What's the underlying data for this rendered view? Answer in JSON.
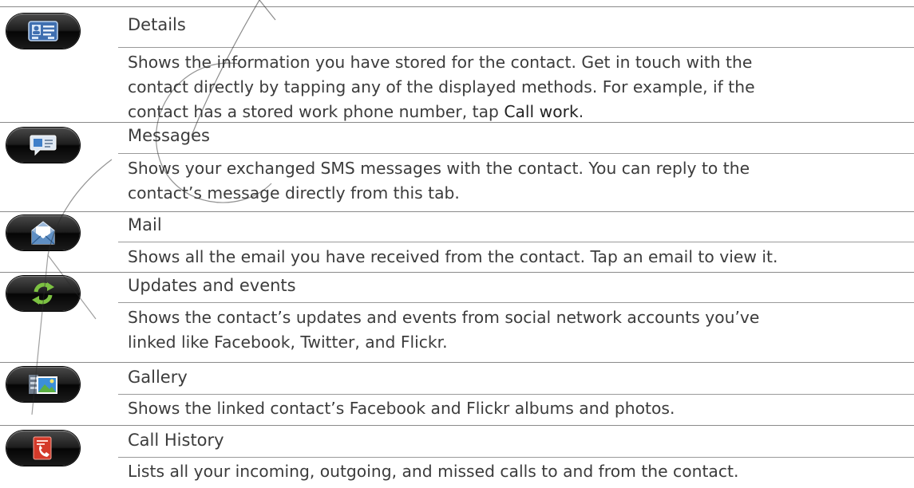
{
  "rows": [
    {
      "title": "Details",
      "icon": "contact-card-icon",
      "desc_before": "Shows the information you have stored for the contact. Get in touch with the\ncontact directly by tapping any of the displayed methods. For example, if the\ncontact has a stored work phone number, tap ",
      "desc_keyword": "Call work",
      "desc_after": "."
    },
    {
      "title": "Messages",
      "icon": "message-bubble-icon",
      "desc": "Shows your exchanged SMS messages with the contact. You can reply to the\ncontact’s message directly from this tab."
    },
    {
      "title": "Mail",
      "icon": "mail-envelope-icon",
      "desc": "Shows all the email you have received from the contact. Tap an email to view it."
    },
    {
      "title": "Updates and events",
      "icon": "refresh-arrows-icon",
      "desc": "Shows the contact’s updates and events from social network accounts you’ve\nlinked like Facebook, Twitter, and Flickr."
    },
    {
      "title": "Gallery",
      "icon": "photo-gallery-icon",
      "desc": "Shows the linked contact’s Facebook and Flickr albums and photos."
    },
    {
      "title": "Call History",
      "icon": "call-history-icon",
      "desc": "Lists all your incoming, outgoing, and missed calls to and from the contact."
    }
  ],
  "colors": {
    "text": "#3c3c3c",
    "rule": "#8a8a8a",
    "icon_bg": "#1c1c1c"
  }
}
